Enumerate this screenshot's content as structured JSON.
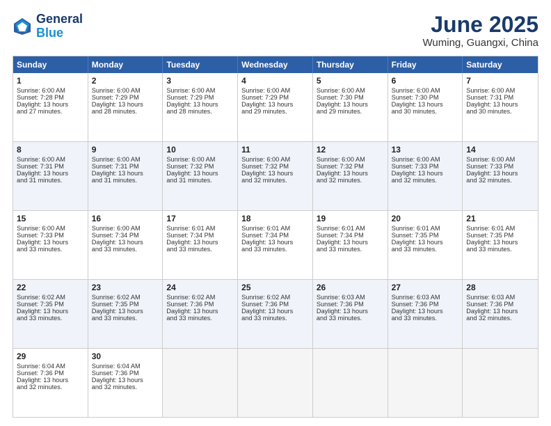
{
  "logo": {
    "line1": "General",
    "line2": "Blue"
  },
  "title": "June 2025",
  "subtitle": "Wuming, Guangxi, China",
  "days": [
    "Sunday",
    "Monday",
    "Tuesday",
    "Wednesday",
    "Thursday",
    "Friday",
    "Saturday"
  ],
  "rows": [
    {
      "alt": false,
      "cells": [
        {
          "day": "1",
          "lines": [
            "Sunrise: 6:00 AM",
            "Sunset: 7:28 PM",
            "Daylight: 13 hours",
            "and 27 minutes."
          ]
        },
        {
          "day": "2",
          "lines": [
            "Sunrise: 6:00 AM",
            "Sunset: 7:29 PM",
            "Daylight: 13 hours",
            "and 28 minutes."
          ]
        },
        {
          "day": "3",
          "lines": [
            "Sunrise: 6:00 AM",
            "Sunset: 7:29 PM",
            "Daylight: 13 hours",
            "and 28 minutes."
          ]
        },
        {
          "day": "4",
          "lines": [
            "Sunrise: 6:00 AM",
            "Sunset: 7:29 PM",
            "Daylight: 13 hours",
            "and 29 minutes."
          ]
        },
        {
          "day": "5",
          "lines": [
            "Sunrise: 6:00 AM",
            "Sunset: 7:30 PM",
            "Daylight: 13 hours",
            "and 29 minutes."
          ]
        },
        {
          "day": "6",
          "lines": [
            "Sunrise: 6:00 AM",
            "Sunset: 7:30 PM",
            "Daylight: 13 hours",
            "and 30 minutes."
          ]
        },
        {
          "day": "7",
          "lines": [
            "Sunrise: 6:00 AM",
            "Sunset: 7:31 PM",
            "Daylight: 13 hours",
            "and 30 minutes."
          ]
        }
      ]
    },
    {
      "alt": true,
      "cells": [
        {
          "day": "8",
          "lines": [
            "Sunrise: 6:00 AM",
            "Sunset: 7:31 PM",
            "Daylight: 13 hours",
            "and 31 minutes."
          ]
        },
        {
          "day": "9",
          "lines": [
            "Sunrise: 6:00 AM",
            "Sunset: 7:31 PM",
            "Daylight: 13 hours",
            "and 31 minutes."
          ]
        },
        {
          "day": "10",
          "lines": [
            "Sunrise: 6:00 AM",
            "Sunset: 7:32 PM",
            "Daylight: 13 hours",
            "and 31 minutes."
          ]
        },
        {
          "day": "11",
          "lines": [
            "Sunrise: 6:00 AM",
            "Sunset: 7:32 PM",
            "Daylight: 13 hours",
            "and 32 minutes."
          ]
        },
        {
          "day": "12",
          "lines": [
            "Sunrise: 6:00 AM",
            "Sunset: 7:32 PM",
            "Daylight: 13 hours",
            "and 32 minutes."
          ]
        },
        {
          "day": "13",
          "lines": [
            "Sunrise: 6:00 AM",
            "Sunset: 7:33 PM",
            "Daylight: 13 hours",
            "and 32 minutes."
          ]
        },
        {
          "day": "14",
          "lines": [
            "Sunrise: 6:00 AM",
            "Sunset: 7:33 PM",
            "Daylight: 13 hours",
            "and 32 minutes."
          ]
        }
      ]
    },
    {
      "alt": false,
      "cells": [
        {
          "day": "15",
          "lines": [
            "Sunrise: 6:00 AM",
            "Sunset: 7:33 PM",
            "Daylight: 13 hours",
            "and 33 minutes."
          ]
        },
        {
          "day": "16",
          "lines": [
            "Sunrise: 6:00 AM",
            "Sunset: 7:34 PM",
            "Daylight: 13 hours",
            "and 33 minutes."
          ]
        },
        {
          "day": "17",
          "lines": [
            "Sunrise: 6:01 AM",
            "Sunset: 7:34 PM",
            "Daylight: 13 hours",
            "and 33 minutes."
          ]
        },
        {
          "day": "18",
          "lines": [
            "Sunrise: 6:01 AM",
            "Sunset: 7:34 PM",
            "Daylight: 13 hours",
            "and 33 minutes."
          ]
        },
        {
          "day": "19",
          "lines": [
            "Sunrise: 6:01 AM",
            "Sunset: 7:34 PM",
            "Daylight: 13 hours",
            "and 33 minutes."
          ]
        },
        {
          "day": "20",
          "lines": [
            "Sunrise: 6:01 AM",
            "Sunset: 7:35 PM",
            "Daylight: 13 hours",
            "and 33 minutes."
          ]
        },
        {
          "day": "21",
          "lines": [
            "Sunrise: 6:01 AM",
            "Sunset: 7:35 PM",
            "Daylight: 13 hours",
            "and 33 minutes."
          ]
        }
      ]
    },
    {
      "alt": true,
      "cells": [
        {
          "day": "22",
          "lines": [
            "Sunrise: 6:02 AM",
            "Sunset: 7:35 PM",
            "Daylight: 13 hours",
            "and 33 minutes."
          ]
        },
        {
          "day": "23",
          "lines": [
            "Sunrise: 6:02 AM",
            "Sunset: 7:35 PM",
            "Daylight: 13 hours",
            "and 33 minutes."
          ]
        },
        {
          "day": "24",
          "lines": [
            "Sunrise: 6:02 AM",
            "Sunset: 7:36 PM",
            "Daylight: 13 hours",
            "and 33 minutes."
          ]
        },
        {
          "day": "25",
          "lines": [
            "Sunrise: 6:02 AM",
            "Sunset: 7:36 PM",
            "Daylight: 13 hours",
            "and 33 minutes."
          ]
        },
        {
          "day": "26",
          "lines": [
            "Sunrise: 6:03 AM",
            "Sunset: 7:36 PM",
            "Daylight: 13 hours",
            "and 33 minutes."
          ]
        },
        {
          "day": "27",
          "lines": [
            "Sunrise: 6:03 AM",
            "Sunset: 7:36 PM",
            "Daylight: 13 hours",
            "and 33 minutes."
          ]
        },
        {
          "day": "28",
          "lines": [
            "Sunrise: 6:03 AM",
            "Sunset: 7:36 PM",
            "Daylight: 13 hours",
            "and 32 minutes."
          ]
        }
      ]
    },
    {
      "alt": false,
      "cells": [
        {
          "day": "29",
          "lines": [
            "Sunrise: 6:04 AM",
            "Sunset: 7:36 PM",
            "Daylight: 13 hours",
            "and 32 minutes."
          ]
        },
        {
          "day": "30",
          "lines": [
            "Sunrise: 6:04 AM",
            "Sunset: 7:36 PM",
            "Daylight: 13 hours",
            "and 32 minutes."
          ]
        },
        {
          "day": "",
          "lines": []
        },
        {
          "day": "",
          "lines": []
        },
        {
          "day": "",
          "lines": []
        },
        {
          "day": "",
          "lines": []
        },
        {
          "day": "",
          "lines": []
        }
      ]
    }
  ]
}
